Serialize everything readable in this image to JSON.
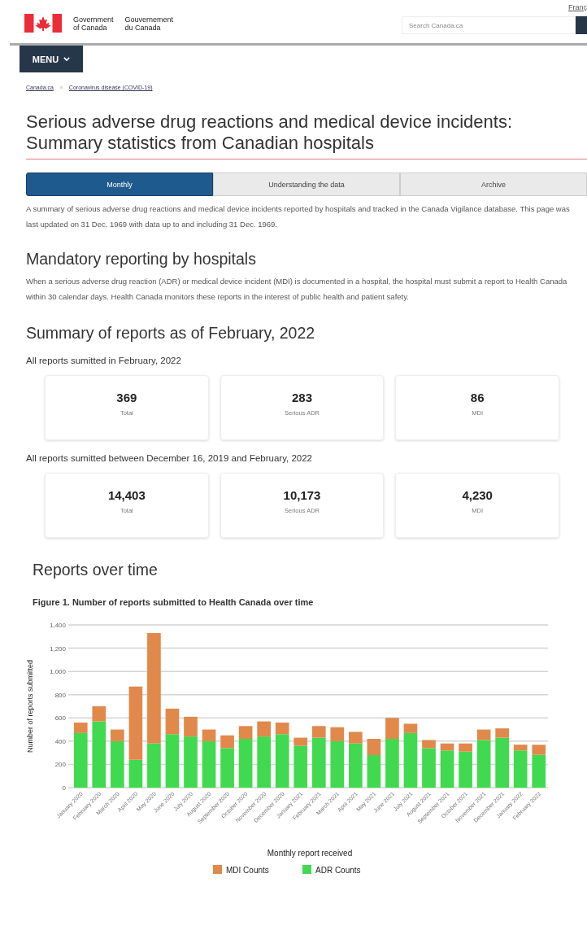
{
  "header": {
    "language_link": "Franç",
    "gov_en": [
      "Government",
      "of Canada"
    ],
    "gov_fr": [
      "Gouvernement",
      "du Canada"
    ],
    "search": {
      "placeholder": "Search Canada.ca"
    }
  },
  "menu": {
    "label": "MENU"
  },
  "breadcrumb": [
    "Canada.ca",
    "Coronavirus disease (COVID-19)"
  ],
  "title": "Serious adverse drug reactions and medical device incidents: Summary statistics from Canadian hospitals",
  "tabs": [
    {
      "label": "Monthly",
      "selected": true
    },
    {
      "label": "Understanding the data",
      "selected": false
    },
    {
      "label": "Archive",
      "selected": false
    }
  ],
  "intro": "A summary of serious adverse drug reactions and medical device incidents reported by hospitals and tracked in the Canada Vigilance database. This page was last updated on 31 Dec. 1969 with data up to and including 31 Dec. 1969.",
  "mandatory": {
    "heading": "Mandatory reporting by hospitals",
    "text": "When a serious adverse drug reaction (ADR) or medical device incident (MDI) is documented in a hospital, the hospital must submit a report to Health Canada within 30 calendar days. Health Canada monitors these reports in the interest of public health and patient safety."
  },
  "summary": {
    "heading": "Summary of reports as of February, 2022",
    "groups": [
      {
        "heading": "All reports sumitted in February, 2022",
        "stats": [
          {
            "value": "369",
            "label": "Total"
          },
          {
            "value": "283",
            "label": "Serious ADR"
          },
          {
            "value": "86",
            "label": "MDI"
          }
        ]
      },
      {
        "heading": "All reports sumitted between December 16, 2019 and February, 2022",
        "stats": [
          {
            "value": "14,403",
            "label": "Total"
          },
          {
            "value": "10,173",
            "label": "Serious ADR"
          },
          {
            "value": "4,230",
            "label": "MDI"
          }
        ]
      }
    ]
  },
  "reports": {
    "heading": "Reports over time",
    "figure_caption": "Figure 1. Number of reports submitted to Health Canada over time",
    "chart_data": {
      "type": "bar",
      "stacked": true,
      "xlabel": "Monthly report received",
      "ylabel": "Number of reports submitted",
      "categories": [
        "January 2020",
        "February 2020",
        "March 2020",
        "April 2020",
        "May 2020",
        "June 2020",
        "July 2020",
        "August 2020",
        "September 2020",
        "October 2020",
        "November 2020",
        "December 2020",
        "January 2021",
        "February 2021",
        "March 2021",
        "April 2021",
        "May 2021",
        "June 2021",
        "July 2021",
        "August 2021",
        "September 2021",
        "October 2021",
        "November 2021",
        "December 2021",
        "January 2022",
        "February 2022"
      ],
      "series": [
        {
          "name": "ADR Counts",
          "color": "#41d94f",
          "values": [
            470,
            570,
            400,
            240,
            380,
            460,
            440,
            400,
            340,
            420,
            440,
            460,
            360,
            430,
            400,
            380,
            280,
            420,
            470,
            340,
            320,
            310,
            410,
            430,
            320,
            283
          ]
        },
        {
          "name": "MDI Counts",
          "color": "#e0894a",
          "values": [
            90,
            130,
            100,
            630,
            950,
            220,
            170,
            100,
            110,
            110,
            130,
            100,
            70,
            100,
            120,
            100,
            140,
            180,
            80,
            70,
            60,
            70,
            90,
            80,
            50,
            86
          ]
        }
      ],
      "ylim": [
        0,
        1400
      ],
      "yticks": [
        {
          "value": 0,
          "label": "0"
        },
        {
          "value": 200,
          "label": "200"
        },
        {
          "value": 400,
          "label": "400"
        },
        {
          "value": 600,
          "label": "600"
        },
        {
          "value": 800,
          "label": "800"
        },
        {
          "value": 1000,
          "label": "1,000"
        },
        {
          "value": 1200,
          "label": "1,200"
        },
        {
          "value": 1400,
          "label": "1,400"
        }
      ],
      "grid": true,
      "legend": true
    }
  }
}
